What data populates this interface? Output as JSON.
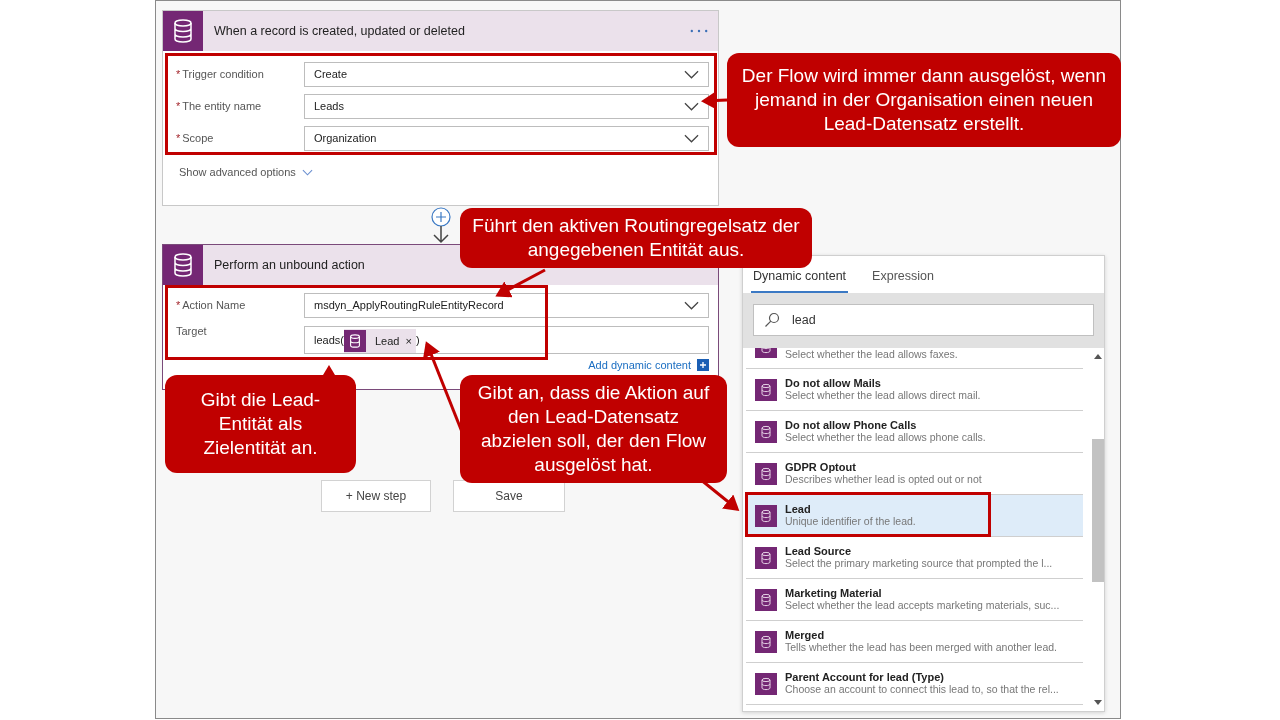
{
  "trigger_card": {
    "title": "When a record is created, updated or deleted",
    "fields": [
      {
        "mark": "*",
        "label": "Trigger condition",
        "value": "Create"
      },
      {
        "mark": "*",
        "label": "The entity name",
        "value": "Leads"
      },
      {
        "mark": "*",
        "label": "Scope",
        "value": "Organization"
      }
    ],
    "advanced_link": "Show advanced options"
  },
  "action_card": {
    "title": "Perform an unbound action",
    "fields": [
      {
        "kind": "dropdown",
        "mark": "*",
        "label": "Action Name",
        "value": "msdyn_ApplyRoutingRuleEntityRecord"
      },
      {
        "kind": "token",
        "label": "Target",
        "prefix": "leads(",
        "token": "Lead",
        "token_close": "×",
        "suffix": ")"
      }
    ],
    "add_dynamic": "Add dynamic content"
  },
  "buttons": [
    "+ New step",
    "Save"
  ],
  "dynamic_panel": {
    "tabs": [
      {
        "label": "Dynamic content",
        "selected": true
      },
      {
        "label": "Expression",
        "selected": false
      }
    ],
    "search": {
      "value": "lead"
    },
    "items": [
      {
        "desc": "Select whether the lead allows faxes.",
        "selected": false
      },
      {
        "name": "Do not allow Mails",
        "desc": "Select whether the lead allows direct mail.",
        "selected": false
      },
      {
        "name": "Do not allow Phone Calls",
        "desc": "Select whether the lead allows phone calls.",
        "selected": false
      },
      {
        "name": "GDPR Optout",
        "desc": "Describes whether lead is opted out or not",
        "selected": false
      },
      {
        "name": "Lead",
        "desc": "Unique identifier of the lead.",
        "selected": true
      },
      {
        "name": "Lead Source",
        "desc": "Select the primary marketing source that prompted the l...",
        "selected": false
      },
      {
        "name": "Marketing Material",
        "desc": "Select whether the lead accepts marketing materials, suc...",
        "selected": false
      },
      {
        "name": "Merged",
        "desc": "Tells whether the lead has been merged with another lead.",
        "selected": false
      },
      {
        "name": "Parent Account for lead (Type)",
        "desc": "Choose an account to connect this lead to, so that the rel...",
        "selected": false
      }
    ]
  },
  "callouts": [
    "Der Flow wird immer dann ausgelöst, wenn jemand in der Organisation einen neuen Lead-Datensatz erstellt.",
    "Führt den aktiven Routingregelsatz der angegebenen Entität aus.",
    "Gibt die Lead-Entität als Zielentität an.",
    "Gibt an, dass die Aktion auf den Lead-Datensatz abzielen soll, der den Flow ausgelöst hat."
  ]
}
